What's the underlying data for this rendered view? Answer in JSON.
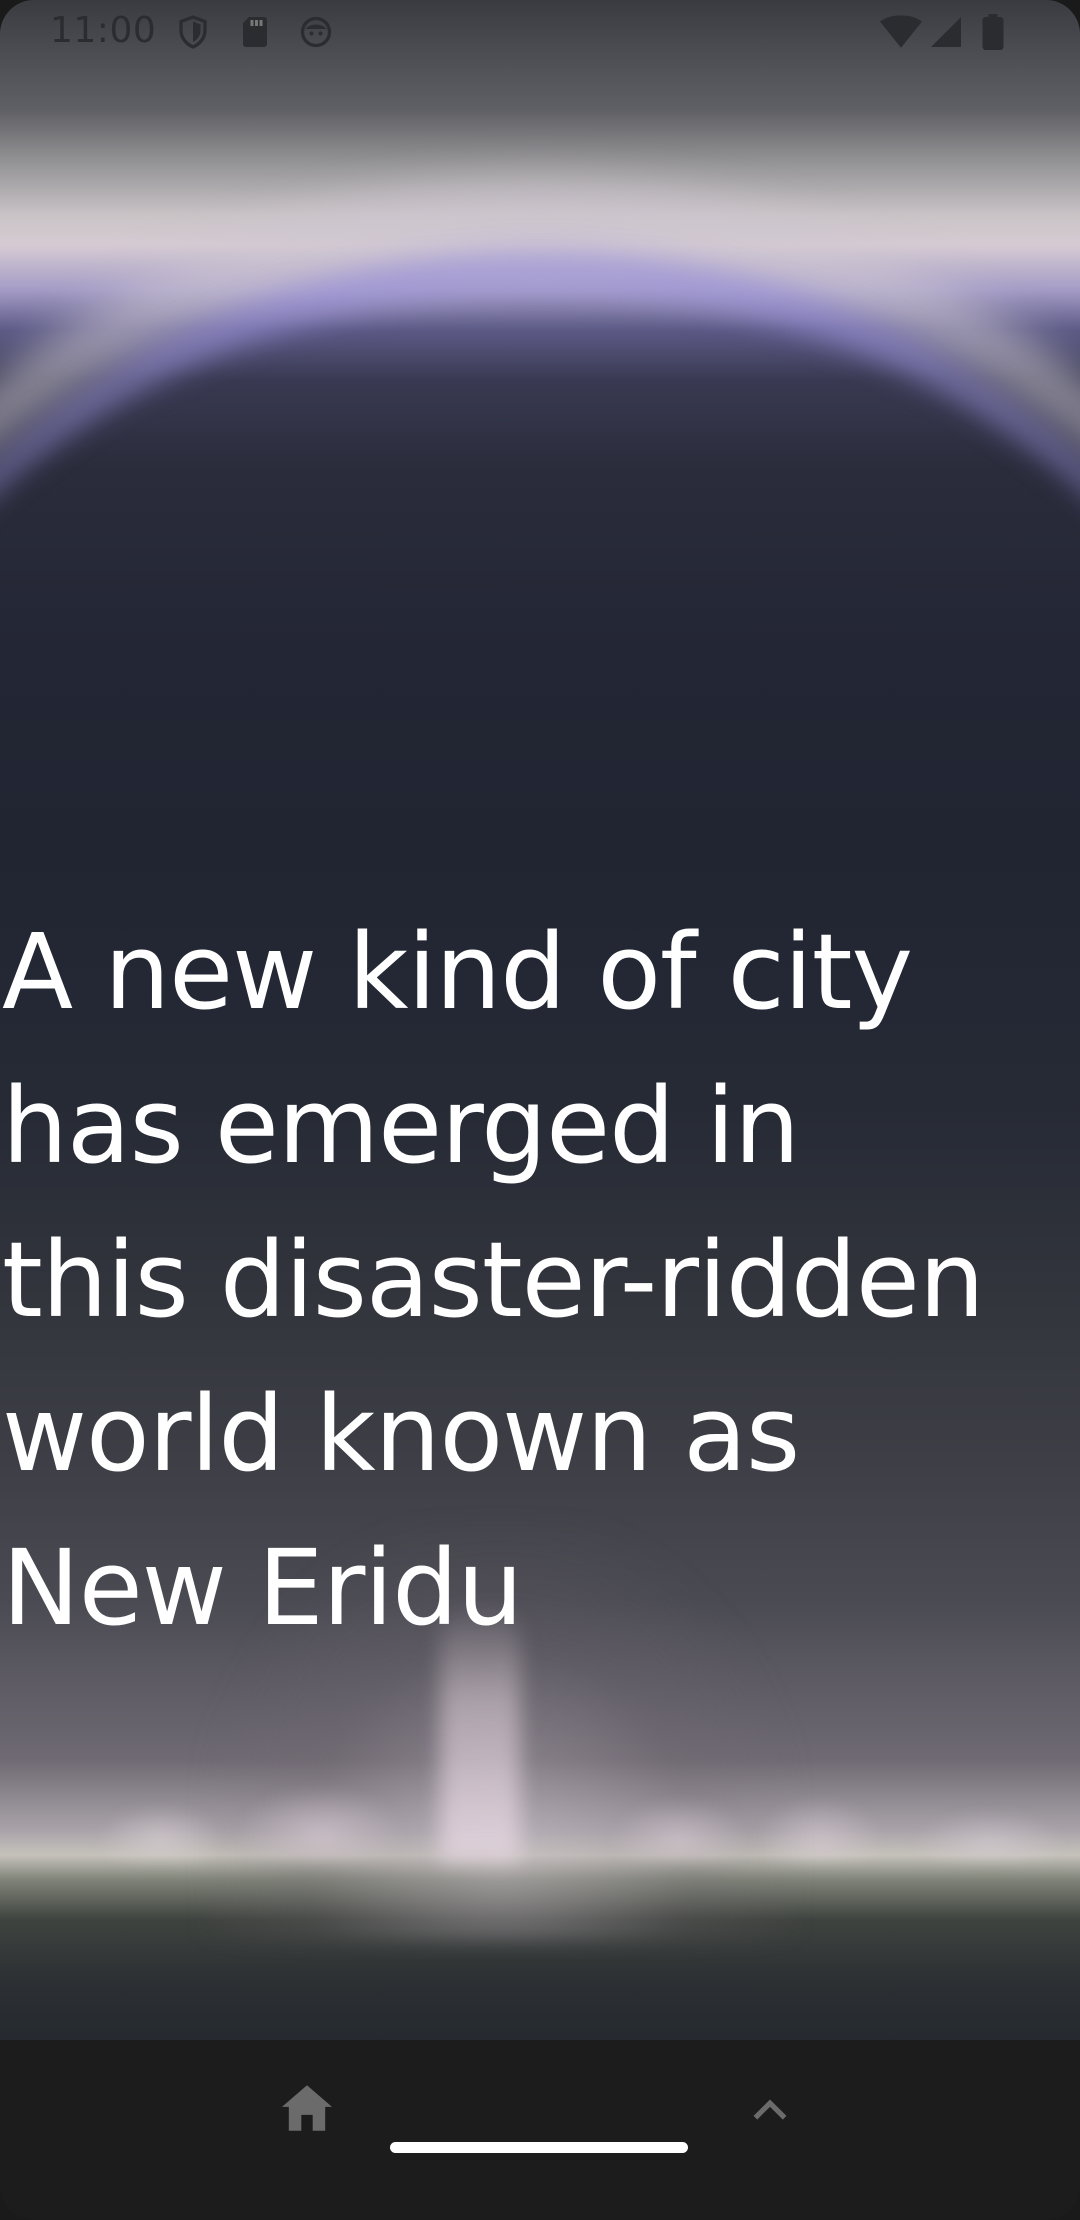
{
  "status_bar": {
    "time": "11:00",
    "left_icons": [
      "shield-icon",
      "sd-card-icon",
      "face-icon"
    ],
    "right_icons": [
      "wifi-icon",
      "cellular-signal-icon",
      "battery-icon"
    ]
  },
  "hero": {
    "headline": "A new kind of city\nhas emerged in\nthis disaster-ridden\nworld known as\nNew Eridu"
  },
  "bottom_nav": {
    "home_icon": "home-icon",
    "expand_icon": "chevron-up-icon"
  },
  "colors": {
    "headline": "#ffffff",
    "nav_background": "#1c1c1c",
    "nav_icon": "#6b6b6b"
  }
}
